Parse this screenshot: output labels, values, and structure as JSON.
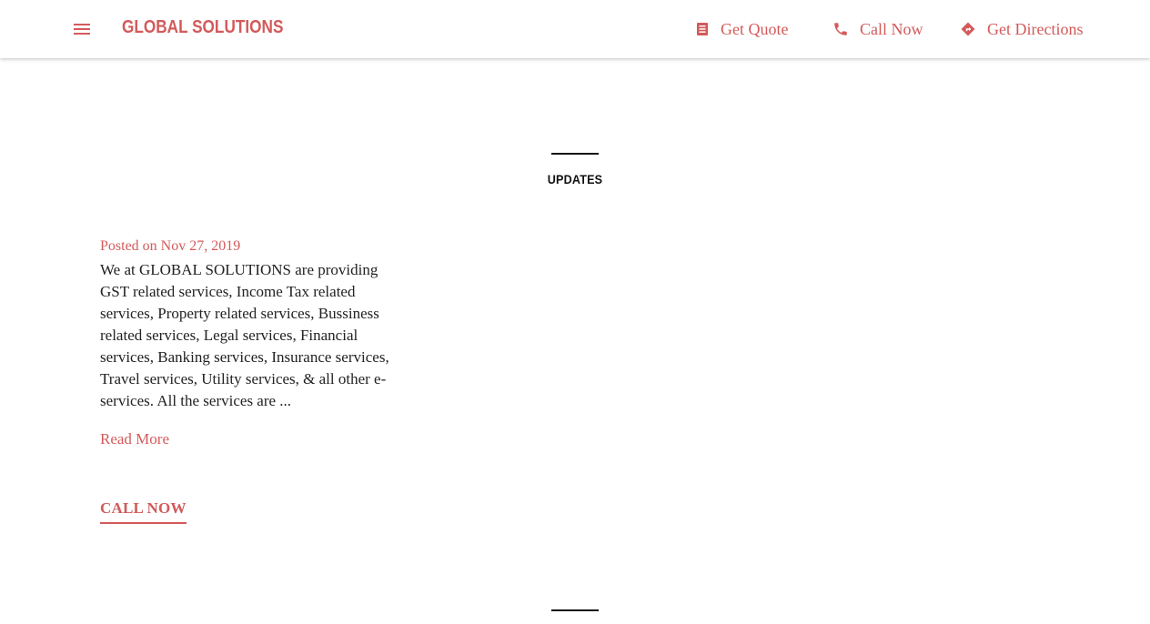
{
  "header": {
    "brand": "GLOBAL SOLUTIONS",
    "actions": [
      {
        "label": "Get Quote",
        "icon": "quote-document-icon"
      },
      {
        "label": "Call Now",
        "icon": "phone-icon"
      },
      {
        "label": "Get Directions",
        "icon": "directions-icon"
      }
    ]
  },
  "updates": {
    "section_title": "UPDATES",
    "post": {
      "date": "Posted on Nov 27, 2019",
      "body": "We at GLOBAL SOLUTIONS are providing GST related services, Income Tax related services, Property related services, Bussiness related services, Legal services, Financial services, Banking services, Insurance services, Travel services, Utility services, & all other e-services. All the services are ...",
      "read_more": "Read More"
    },
    "cta": "CALL NOW"
  },
  "colors": {
    "accent": "#d35a5a",
    "text": "#222222",
    "rule": "#111111"
  }
}
